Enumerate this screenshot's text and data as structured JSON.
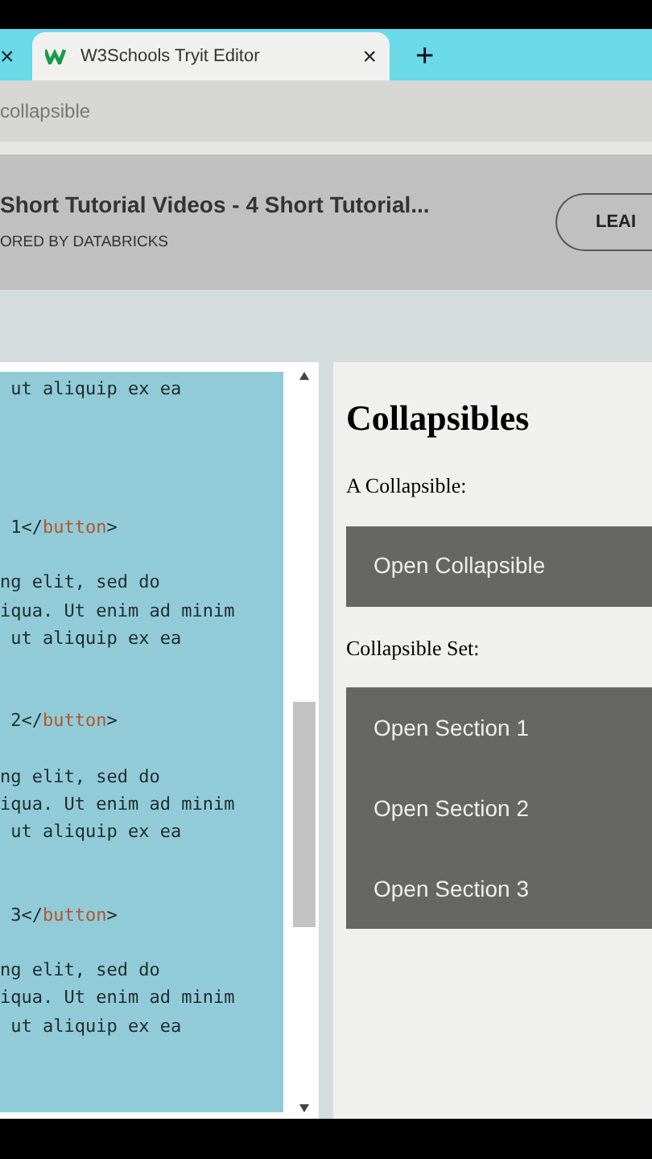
{
  "browser": {
    "tabs": [
      {
        "selected": false,
        "close": "×"
      },
      {
        "title": "W3Schools Tryit Editor",
        "selected": true,
        "close": "×"
      }
    ],
    "new_tab": "+",
    "address": "collapsible"
  },
  "ad": {
    "title": "Short Tutorial Videos - 4 Short Tutorial...",
    "sponsor": "ORED BY DATABRICKS",
    "button": "LEAI"
  },
  "editor": {
    "lines": [
      {
        "kind": "code",
        "segments": [
          {
            "text": " ut aliquip ex ea",
            "kind": "text"
          }
        ]
      },
      {
        "kind": "blank"
      },
      {
        "kind": "blank"
      },
      {
        "kind": "blank"
      },
      {
        "kind": "blank"
      },
      {
        "kind": "code",
        "segments": [
          {
            "text": " 1",
            "kind": "text"
          },
          {
            "text": "</",
            "kind": "punct"
          },
          {
            "text": "button",
            "kind": "tag"
          },
          {
            "text": ">",
            "kind": "punct"
          }
        ]
      },
      {
        "kind": "blank"
      },
      {
        "kind": "code",
        "segments": [
          {
            "text": "ng elit, sed do",
            "kind": "text"
          }
        ]
      },
      {
        "kind": "code",
        "segments": [
          {
            "text": "iqua. Ut enim ad minim",
            "kind": "text"
          }
        ]
      },
      {
        "kind": "code",
        "segments": [
          {
            "text": " ut aliquip ex ea",
            "kind": "text"
          }
        ]
      },
      {
        "kind": "blank"
      },
      {
        "kind": "blank"
      },
      {
        "kind": "code",
        "segments": [
          {
            "text": " 2",
            "kind": "text"
          },
          {
            "text": "</",
            "kind": "punct"
          },
          {
            "text": "button",
            "kind": "tag"
          },
          {
            "text": ">",
            "kind": "punct"
          }
        ]
      },
      {
        "kind": "blank"
      },
      {
        "kind": "code",
        "segments": [
          {
            "text": "ng elit, sed do",
            "kind": "text"
          }
        ]
      },
      {
        "kind": "code",
        "segments": [
          {
            "text": "iqua. Ut enim ad minim",
            "kind": "text"
          }
        ]
      },
      {
        "kind": "code",
        "segments": [
          {
            "text": " ut aliquip ex ea",
            "kind": "text"
          }
        ]
      },
      {
        "kind": "blank"
      },
      {
        "kind": "blank"
      },
      {
        "kind": "code",
        "segments": [
          {
            "text": " 3",
            "kind": "text"
          },
          {
            "text": "</",
            "kind": "punct"
          },
          {
            "text": "button",
            "kind": "tag"
          },
          {
            "text": ">",
            "kind": "punct"
          }
        ]
      },
      {
        "kind": "blank"
      },
      {
        "kind": "code",
        "segments": [
          {
            "text": "ng elit, sed do",
            "kind": "text"
          }
        ]
      },
      {
        "kind": "code",
        "segments": [
          {
            "text": "iqua. Ut enim ad minim",
            "kind": "text"
          }
        ]
      },
      {
        "kind": "code",
        "segments": [
          {
            "text": " ut aliquip ex ea",
            "kind": "text"
          }
        ]
      }
    ]
  },
  "result": {
    "heading": "Collapsibles",
    "label_single": "A Collapsible:",
    "single_button": "Open Collapsible",
    "label_set": "Collapsible Set:",
    "set_buttons": [
      "Open Section 1",
      "Open Section 2",
      "Open Section 3"
    ]
  }
}
